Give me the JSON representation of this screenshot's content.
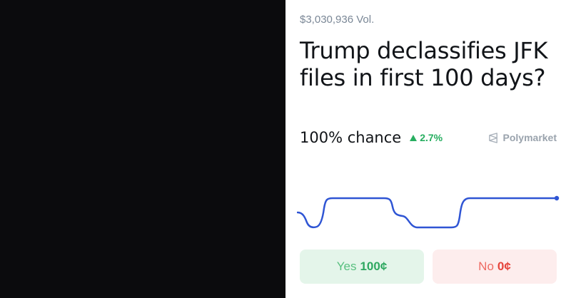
{
  "market": {
    "volume": "$3,030,936 Vol.",
    "title": "Trump declassifies JFK files in first 100 days?",
    "chance": "100% chance",
    "change": "2.7%",
    "source": "Polymarket"
  },
  "buttons": {
    "yes_label": "Yes",
    "yes_price": "100¢",
    "no_label": "No",
    "no_price": "0¢"
  },
  "colors": {
    "line": "#2f55d4",
    "up": "#27ae60",
    "yes": "#2ea860",
    "no": "#e6453c"
  },
  "icons": {
    "change": "triangle-up-icon",
    "source": "polymarket-logo-icon"
  }
}
